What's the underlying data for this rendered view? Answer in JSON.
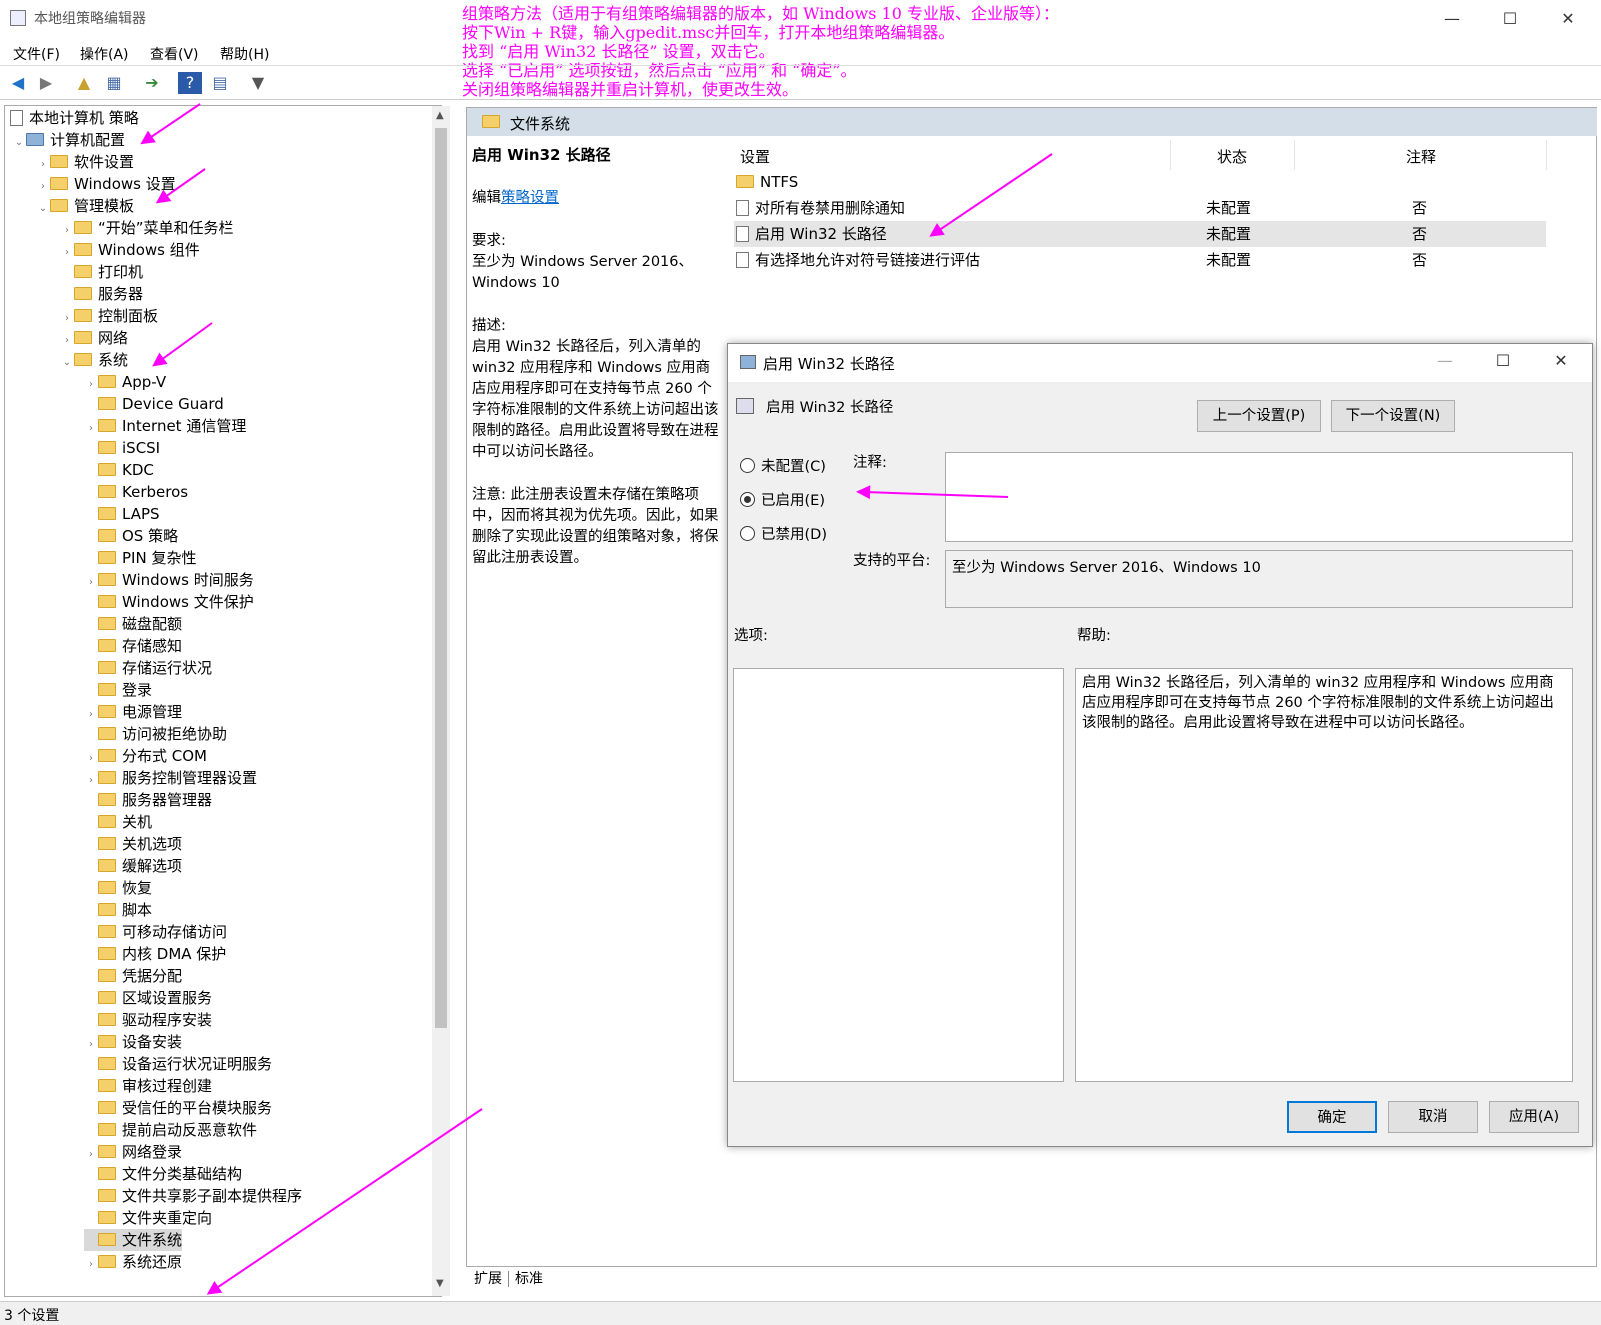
{
  "window": {
    "title": "本地组策略编辑器",
    "minimize": "—",
    "maximize": "☐",
    "close": "✕"
  },
  "menu": [
    "文件(F)",
    "操作(A)",
    "查看(V)",
    "帮助(H)"
  ],
  "annotation": [
    "组策略方法（适用于有组策略编辑器的版本，如 Windows 10 专业版、企业版等）：",
    "按下Win + R键，输入gpedit.msc并回车，打开本地组策略编辑器。",
    "找到 “启用 Win32 长路径” 设置，双击它。",
    "选择 “已启用” 选项按钮，然后点击 “应用” 和 “确定”。",
    "关闭组策略编辑器并重启计算机，使更改生效。"
  ],
  "tree": {
    "root": "本地计算机 策略",
    "computer_config": "计算机配置",
    "software": "软件设置",
    "windows_settings": "Windows 设置",
    "admin_templates": "管理模板",
    "l3": [
      "“开始”菜单和任务栏",
      "Windows 组件",
      "打印机",
      "服务器",
      "控制面板",
      "网络",
      "系统"
    ],
    "system_children": [
      "App-V",
      "Device Guard",
      "Internet 通信管理",
      "iSCSI",
      "KDC",
      "Kerberos",
      "LAPS",
      "OS 策略",
      "PIN 复杂性",
      "Windows 时间服务",
      "Windows 文件保护",
      "磁盘配额",
      "存储感知",
      "存储运行状况",
      "登录",
      "电源管理",
      "访问被拒绝协助",
      "分布式 COM",
      "服务控制管理器设置",
      "服务器管理器",
      "关机",
      "关机选项",
      "缓解选项",
      "恢复",
      "脚本",
      "可移动存储访问",
      "内核 DMA 保护",
      "凭据分配",
      "区域设置服务",
      "驱动程序安装",
      "设备安装",
      "设备运行状况证明服务",
      "审核过程创建",
      "受信任的平台模块服务",
      "提前启动反恶意软件",
      "网络登录",
      "文件分类基础结构",
      "文件共享影子副本提供程序",
      "文件夹重定向",
      "文件系统",
      "系统还原"
    ]
  },
  "right_header": "文件系统",
  "description": {
    "title": "启用 Win32 长路径",
    "edit_prefix": "编辑",
    "edit_link": "策略设置",
    "req_label": "要求:",
    "req_text": "至少为 Windows Server 2016、Windows 10",
    "desc_label": "描述:",
    "desc_text": "启用 Win32 长路径后，列入清单的 win32 应用程序和 Windows 应用商店应用程序即可在支持每节点 260 个字符标准限制的文件系统上访问超出该限制的路径。启用此设置将导致在进程中可以访问长路径。",
    "note_text": "注意: 此注册表设置未存储在策略项中，因而将其视为优先项。因此，如果删除了实现此设置的组策略对象，将保留此注册表设置。"
  },
  "list": {
    "columns": [
      "设置",
      "状态",
      "注释"
    ],
    "folder": "NTFS",
    "rows": [
      {
        "name": "对所有卷禁用删除通知",
        "state": "未配置",
        "comment": "否"
      },
      {
        "name": "启用 Win32 长路径",
        "state": "未配置",
        "comment": "否"
      },
      {
        "name": "有选择地允许对符号链接进行评估",
        "state": "未配置",
        "comment": "否"
      }
    ]
  },
  "tabs": [
    "扩展",
    "标准"
  ],
  "status": "3 个设置",
  "dialog": {
    "title": "启用 Win32 长路径",
    "setting_name": "启用 Win32 长路径",
    "prev": "上一个设置(P)",
    "next": "下一个设置(N)",
    "not_configured": "未配置(C)",
    "enabled": "已启用(E)",
    "disabled": "已禁用(D)",
    "selected": "enabled",
    "comment_label": "注释:",
    "platform_label": "支持的平台:",
    "platform_value": "至少为 Windows Server 2016、Windows 10",
    "options_label": "选项:",
    "help_label": "帮助:",
    "help_text": "启用 Win32 长路径后，列入清单的 win32 应用程序和 Windows 应用商店应用程序即可在支持每节点 260 个字符标准限制的文件系统上访问超出该限制的路径。启用此设置将导致在进程中可以访问长路径。",
    "ok": "确定",
    "cancel": "取消",
    "apply": "应用(A)"
  },
  "colors": {
    "accent": "#0078d7",
    "annotation": "#ff00ff",
    "header": "#d3dee9"
  }
}
